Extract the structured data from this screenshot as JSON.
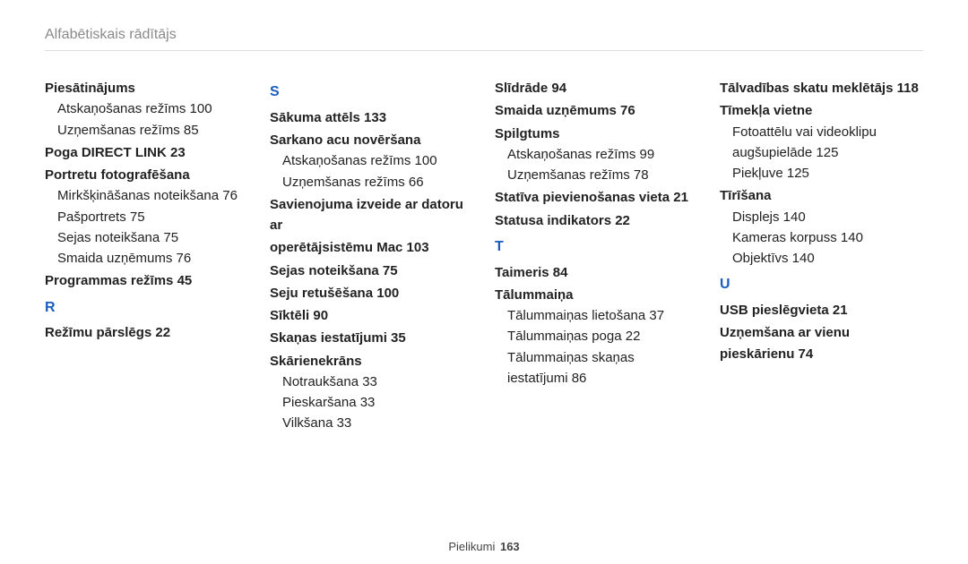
{
  "header": "Alfabētiskais rādītājs",
  "footer": {
    "section": "Pielikumi",
    "page": "163"
  },
  "col1": {
    "piesat_h": "Piesātinājums",
    "piesat_s1": "Atskaņošanas režīms  100",
    "piesat_s2": "Uzņemšanas režīms  85",
    "poga_h": "Poga DIRECT LINK  23",
    "portret_h": "Portretu fotografēšana",
    "portret_s1": "Mirkšķināšanas noteikšana  76",
    "portret_s2": "Pašportrets  75",
    "portret_s3": "Sejas noteikšana  75",
    "portret_s4": "Smaida uzņēmums  76",
    "prog_h": "Programmas režīms  45",
    "letter_R": "R",
    "rezimu_h": "Režīmu pārslēgs  22"
  },
  "col2": {
    "letter_S": "S",
    "sakuma_h": "Sākuma attēls  133",
    "sarkano_h": "Sarkano acu novēršana",
    "sarkano_s1": "Atskaņošanas režīms  100",
    "sarkano_s2": "Uzņemšanas režīms  66",
    "savien_h1": "Savienojuma izveide ar datoru ar",
    "savien_h2": "operētājsistēmu Mac  103",
    "sejas_h": "Sejas noteikšana  75",
    "seju_h": "Seju retušēšana  100",
    "sikteli_h": "Sīktēli  90",
    "skanas_h": "Skaņas iestatījumi  35",
    "skarien_h": "Skārienekrāns",
    "skarien_s1": "Notraukšana  33",
    "skarien_s2": "Pieskaršana  33",
    "skarien_s3": "Vilkšana  33"
  },
  "col3": {
    "slid_h": "Slīdrāde  94",
    "smaida_h": "Smaida uzņēmums  76",
    "spilg_h": "Spilgtums",
    "spilg_s1": "Atskaņošanas režīms  99",
    "spilg_s2": "Uzņemšanas režīms  78",
    "stativ_h": "Statīva pievienošanas vieta  21",
    "status_h": "Statusa indikators  22",
    "letter_T": "T",
    "taimeris_h": "Taimeris  84",
    "talum_h": "Tālummaiņa",
    "talum_s1": "Tālummaiņas lietošana  37",
    "talum_s2": "Tālummaiņas poga  22",
    "talum_s3": "Tālummaiņas skaņas iestatījumi  86"
  },
  "col4": {
    "talvad_h": "Tālvadības skatu meklētājs  118",
    "timekla_h": "Tīmekļa vietne",
    "timekla_s1a": "Fotoattēlu vai videoklipu",
    "timekla_s1b": "augšupielāde  125",
    "timekla_s2": "Piekļuve  125",
    "tiris_h": "Tīrīšana",
    "tiris_s1": "Displejs  140",
    "tiris_s2": "Kameras korpuss  140",
    "tiris_s3": "Objektīvs  140",
    "letter_U": "U",
    "usb_h": "USB pieslēgvieta  21",
    "uznem_h": "Uzņemšana ar vienu pieskārienu  74"
  }
}
